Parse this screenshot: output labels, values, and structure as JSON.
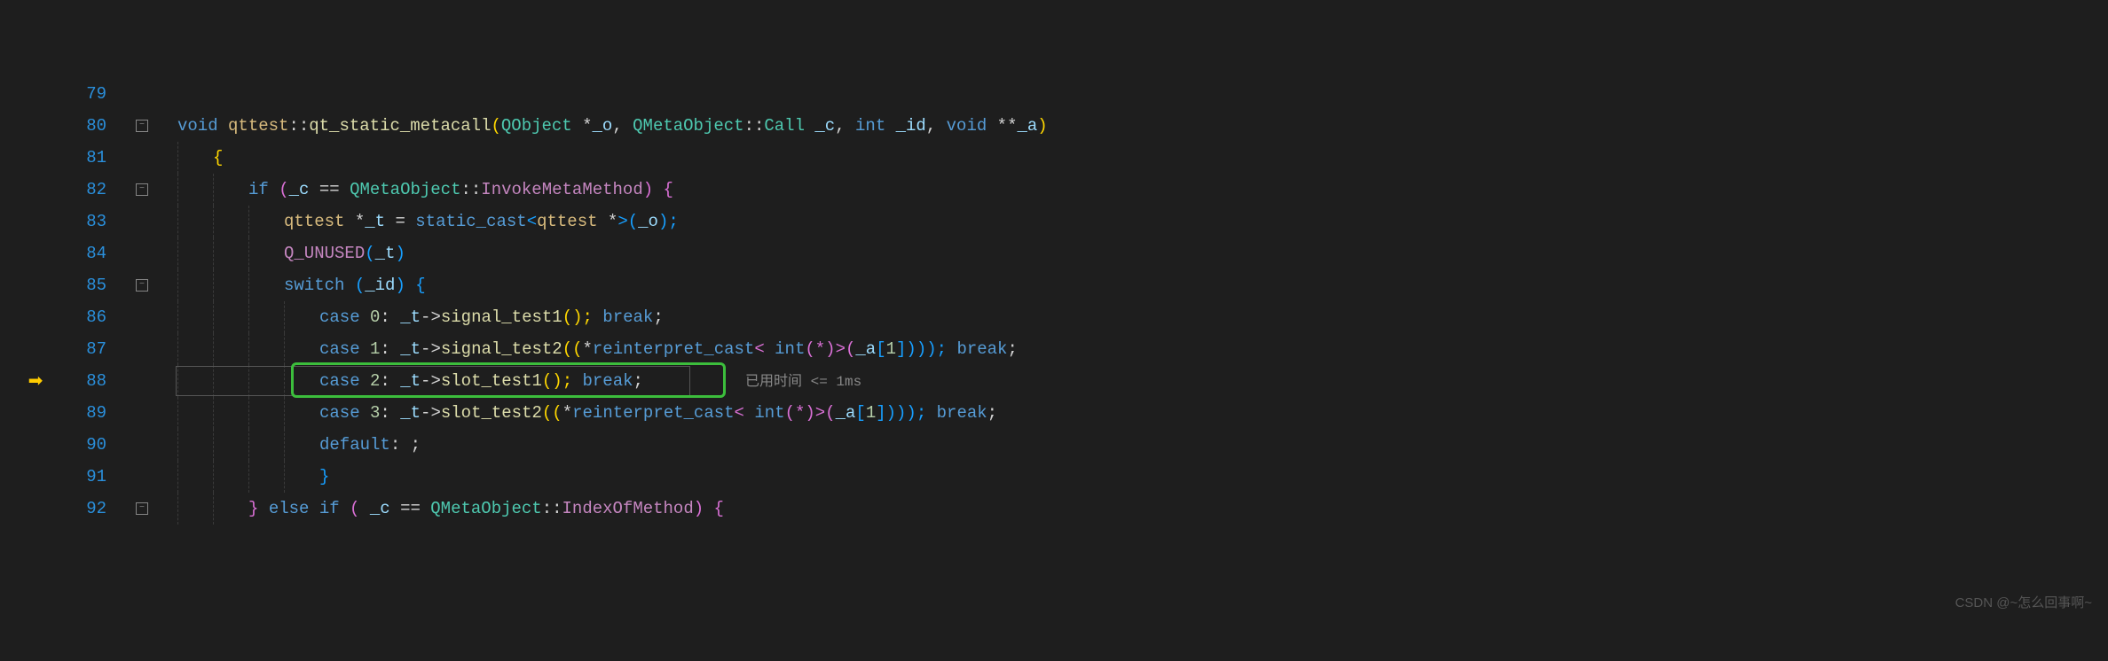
{
  "lines": {
    "l79": "79",
    "l80": "80",
    "l81": "81",
    "l82": "82",
    "l83": "83",
    "l84": "84",
    "l85": "85",
    "l86": "86",
    "l87": "87",
    "l88": "88",
    "l89": "89",
    "l90": "90",
    "l91": "91",
    "l92": "92"
  },
  "code": {
    "l80": {
      "kw_void": "void ",
      "cls": "qttest",
      "op1": "::",
      "fn": "qt_static_metacall",
      "p1": "(",
      "ty1": "QObject ",
      "op2": "*",
      "var1": "_o",
      ", ": ", ",
      "ty2": "QMetaObject",
      "op3": "::",
      "ty3": "Call ",
      "var2": "_c",
      ", 2": ", ",
      "kw_int": "int ",
      "var3": "_id",
      ", 3": ", ",
      "kw_void2": "void ",
      "op4": "**",
      "var4": "_a",
      "p2": ")"
    },
    "l81": {
      "brace": "{"
    },
    "l82": {
      "kw_if": "if ",
      "p1": "(",
      "var1": "_c ",
      "op": "== ",
      "ty": "QMetaObject",
      "cc": "::",
      "fn": "InvokeMetaMethod",
      "p2": ") {"
    },
    "l83": {
      "ty": "qttest ",
      "op": "*",
      "var1": "_t ",
      "eq": "= ",
      "fn": "static_cast",
      "lt": "<",
      "ty2": "qttest ",
      "star": "*",
      "gt": ">(",
      "var2": "_o",
      "p": ");"
    },
    "l84": {
      "mac": "Q_UNUSED",
      "p1": "(",
      "var": "_t",
      "p2": ")"
    },
    "l85": {
      "kw": "switch ",
      "p1": "(",
      "var": "_id",
      "p2": ") {"
    },
    "l86": {
      "kw": "case ",
      "n": "0",
      "col": ": ",
      "var": "_t",
      "arr": "->",
      "fn": "signal_test1",
      "p": "(); ",
      "br": "break",
      ";": ";"
    },
    "l87": {
      "kw": "case ",
      "n": "1",
      "col": ": ",
      "var": "_t",
      "arr": "->",
      "fn": "signal_test2",
      "p1": "((",
      "star": "*",
      "rc": "reinterpret_cast",
      "lt": "< ",
      "int": "int",
      "pst": "(*)>(",
      "var2": "_a",
      "br1": "[",
      "n2": "1",
      "br2": "]))); ",
      "brk": "break",
      ";": ";"
    },
    "l88": {
      "kw": "case ",
      "n": "2",
      "col": ": ",
      "var": "_t",
      "arr": "->",
      "fn": "slot_test1",
      "p": "(); ",
      "br": "break",
      ";": ";"
    },
    "l89": {
      "kw": "case ",
      "n": "3",
      "col": ": ",
      "var": "_t",
      "arr": "->",
      "fn": "slot_test2",
      "p1": "((",
      "star": "*",
      "rc": "reinterpret_cast",
      "lt": "< ",
      "int": "int",
      "pst": "(*)>(",
      "var2": "_a",
      "br1": "[",
      "n2": "1",
      "br2": "]))); ",
      "brk": "break",
      ";": ";"
    },
    "l90": {
      "kw": "default",
      "col": ": ;"
    },
    "l91": {
      "brace": "}"
    },
    "l92": {
      "brace": "} ",
      "kw": "else if ",
      "p1": "( ",
      "var": "_c ",
      "op": "== ",
      "ty": "QMetaObject",
      "cc": "::",
      "fn": "IndexOfMethod",
      "p2": ") {"
    }
  },
  "perf": {
    "label": "已用时间 ",
    "op": "<= ",
    "val": "1ms"
  },
  "watermark": "CSDN @~怎么回事啊~",
  "fold": {
    "minus": "−"
  }
}
